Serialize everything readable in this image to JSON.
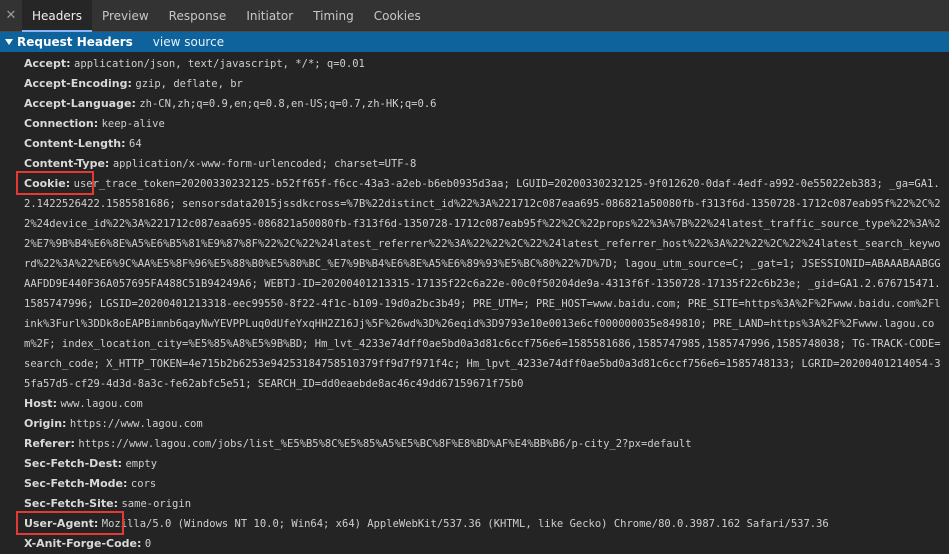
{
  "tabs": [
    "Headers",
    "Preview",
    "Response",
    "Initiator",
    "Timing",
    "Cookies"
  ],
  "section": {
    "title": "Request Headers",
    "link": "view source"
  },
  "headers": [
    {
      "name": "Accept:",
      "value": "application/json, text/javascript, */*; q=0.01"
    },
    {
      "name": "Accept-Encoding:",
      "value": "gzip, deflate, br"
    },
    {
      "name": "Accept-Language:",
      "value": "zh-CN,zh;q=0.9,en;q=0.8,en-US;q=0.7,zh-HK;q=0.6"
    },
    {
      "name": "Connection:",
      "value": "keep-alive"
    },
    {
      "name": "Content-Length:",
      "value": "64"
    },
    {
      "name": "Content-Type:",
      "value": "application/x-www-form-urlencoded; charset=UTF-8"
    },
    {
      "name": "Cookie:",
      "value": "user_trace_token=20200330232125-b52ff65f-f6cc-43a3-a2eb-b6eb0935d3aa; LGUID=20200330232125-9f012620-0daf-4edf-a992-0e55022eb383; _ga=GA1.2.1422526422.1585581686; sensorsdata2015jssdkcross=%7B%22distinct_id%22%3A%221712c087eaa695-086821a50080fb-f313f6d-1350728-1712c087eab95f%22%2C%22%24device_id%22%3A%221712c087eaa695-086821a50080fb-f313f6d-1350728-1712c087eab95f%22%2C%22props%22%3A%7B%22%24latest_traffic_source_type%22%3A%22%E7%9B%B4%E6%8E%A5%E6%B5%81%E9%87%8F%22%2C%22%24latest_referrer%22%3A%22%22%2C%22%24latest_referrer_host%22%3A%22%22%2C%22%24latest_search_keyword%22%3A%22%E6%9C%AA%E5%8F%96%E5%88%B0%E5%80%BC_%E7%9B%B4%E6%8E%A5%E6%89%93%E5%BC%80%22%7D%7D; lagou_utm_source=C; _gat=1; JSESSIONID=ABAAABAABGGAAFDD9E440F36A057695FA488C51B94249A6; WEBTJ-ID=20200401213315-17135f22c6a22e-00c0f50204de9a-4313f6f-1350728-17135f22c6b23e; _gid=GA1.2.676715471.1585747996; LGSID=20200401213318-eec99550-8f22-4f1c-b109-19d0a2bc3b49; PRE_UTM=; PRE_HOST=www.baidu.com; PRE_SITE=https%3A%2F%2Fwww.baidu.com%2Flink%3Furl%3DDk8oEAPBimnb6qayNwYEVPPLuq0dUfeYxqHH2Z16Jj%5F%26wd%3D%26eqid%3D9793e10e0013e6cf000000035e849810; PRE_LAND=https%3A%2F%2Fwww.lagou.com%2F; index_location_city=%E5%85%A8%E5%9B%BD; Hm_lvt_4233e74dff0ae5bd0a3d81c6ccf756e6=1585581686,1585747985,1585747996,1585748038; TG-TRACK-CODE=search_code; X_HTTP_TOKEN=4e715b2b6253e94253184758510379ff9d7f971f4c; Hm_lpvt_4233e74dff0ae5bd0a3d81c6ccf756e6=1585748133; LGRID=20200401214054-35fa57d5-cf29-4d3d-8a3c-fe62abfc5e51; SEARCH_ID=dd0eaebde8ac46c49dd67159671f75b0"
    },
    {
      "name": "Host:",
      "value": "www.lagou.com"
    },
    {
      "name": "Origin:",
      "value": "https://www.lagou.com"
    },
    {
      "name": "Referer:",
      "value": "https://www.lagou.com/jobs/list_%E5%B5%8C%E5%85%A5%E5%BC%8F%E8%BD%AF%E4%BB%B6/p-city_2?px=default"
    },
    {
      "name": "Sec-Fetch-Dest:",
      "value": "empty"
    },
    {
      "name": "Sec-Fetch-Mode:",
      "value": "cors"
    },
    {
      "name": "Sec-Fetch-Site:",
      "value": "same-origin"
    },
    {
      "name": "User-Agent:",
      "value": "Mozilla/5.0 (Windows NT 10.0; Win64; x64) AppleWebKit/537.36 (KHTML, like Gecko) Chrome/80.0.3987.162 Safari/537.36"
    },
    {
      "name": "X-Anit-Forge-Code:",
      "value": "0"
    }
  ],
  "colors": {
    "accent": "#0e639c",
    "highlight": "#e53935",
    "tab_underline": "#8ab4f8"
  }
}
